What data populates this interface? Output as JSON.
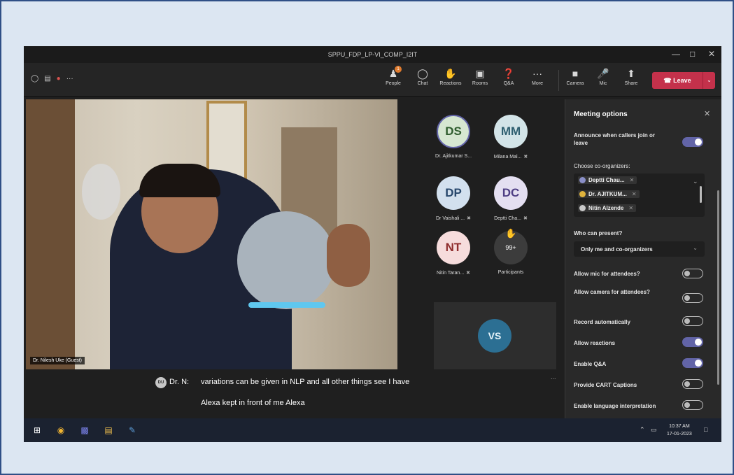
{
  "window": {
    "title": "SPPU_FDP_LP-VI_COMP_I2IT"
  },
  "toolbar": {
    "left_icons": [
      "shield-icon",
      "caption-icon",
      "record-indicator-icon",
      "more-dots-icon"
    ],
    "people_badge": "1",
    "buttons": [
      {
        "id": "people",
        "icon": "people-icon",
        "label": "People"
      },
      {
        "id": "chat",
        "icon": "chat-icon",
        "label": "Chat"
      },
      {
        "id": "reactions",
        "icon": "reactions-icon",
        "label": "Reactions"
      },
      {
        "id": "rooms",
        "icon": "rooms-icon",
        "label": "Rooms"
      },
      {
        "id": "qa",
        "icon": "qa-icon",
        "label": "Q&A"
      },
      {
        "id": "more",
        "icon": "more-icon",
        "label": "More"
      },
      {
        "id": "camera",
        "icon": "camera-off-icon",
        "label": "Camera"
      },
      {
        "id": "mic",
        "icon": "mic-off-icon",
        "label": "Mic"
      },
      {
        "id": "share",
        "icon": "share-icon",
        "label": "Share"
      }
    ],
    "leave_label": "Leave",
    "accent_leave": "#c4314b"
  },
  "video": {
    "speaker_name": "Dr. Nilesh Uke (Guest)"
  },
  "participants": [
    {
      "initials": "DS",
      "name": "Dr. Ajitkumar S...",
      "bg": "#d6e7d1",
      "fg": "#2f5d2e",
      "muted": false
    },
    {
      "initials": "MM",
      "name": "Milana Mal...",
      "bg": "#d3e4e8",
      "fg": "#2f5f70",
      "muted": true
    },
    {
      "initials": "DP",
      "name": "Dr Vaishali ...",
      "bg": "#d2e0ee",
      "fg": "#27476c",
      "muted": true
    },
    {
      "initials": "DC",
      "name": "Deptti Cha...",
      "bg": "#e4dff1",
      "fg": "#4f3f85",
      "muted": true
    },
    {
      "initials": "NT",
      "name": "Nitin Taran...",
      "bg": "#f6dcdc",
      "fg": "#8f2d2d",
      "muted": true
    },
    {
      "initials": "99+",
      "name": "Participants",
      "bg": "#3c3c3c",
      "fg": "#ffffff",
      "muted": false
    }
  ],
  "spotlight_tile": {
    "initials": "VS"
  },
  "captions": {
    "avatar": "DU",
    "speaker": "Dr. N:",
    "line1": "variations can be given in NLP and all other things see I have",
    "line2": "Alexa kept in front of me Alexa",
    "more": "..."
  },
  "panel": {
    "title": "Meeting options",
    "announce_label": "Announce when callers join or leave",
    "announce_on": true,
    "coorganizers_label": "Choose co-organizers:",
    "coorganizers": [
      "Deptti Chau...",
      "Dr. AJITKUM...",
      "Nitin Alzende"
    ],
    "who_present_label": "Who can present?",
    "who_present_value": "Only me and co-organizers",
    "options": [
      {
        "label": "Allow mic for attendees?",
        "on": false
      },
      {
        "label": "Allow camera for attendees?",
        "on": false
      },
      {
        "label": "Record automatically",
        "on": false
      },
      {
        "label": "Allow reactions",
        "on": true
      },
      {
        "label": "Enable Q&A",
        "on": true
      },
      {
        "label": "Provide CART Captions",
        "on": false
      },
      {
        "label": "Enable language interpretation",
        "on": false
      }
    ],
    "accent": "#6264a7"
  },
  "taskbar": {
    "apps": [
      "windows-start-icon",
      "chrome-icon",
      "teams-icon",
      "file-explorer-icon",
      "notes-icon"
    ],
    "time": "10:37 AM",
    "date": "17-01-2023"
  }
}
